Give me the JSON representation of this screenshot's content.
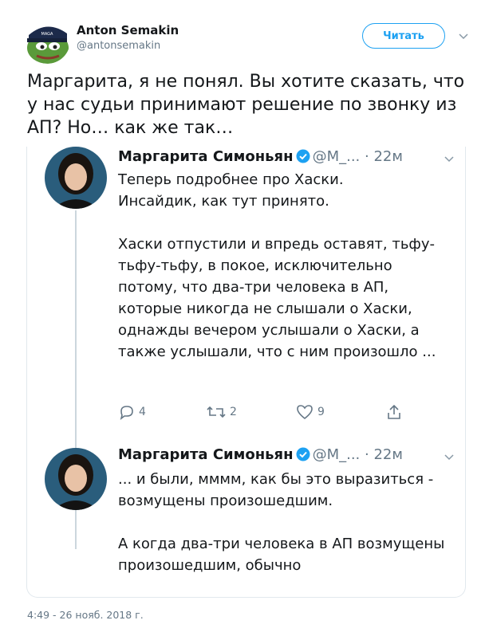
{
  "author": {
    "name": "Anton Semakin",
    "handle": "@antonsemakin",
    "follow_label": "Читать"
  },
  "tweet": {
    "text": "Маргарита, я не понял. Вы хотите сказать, что у нас судьи принимают решение по звонку из АП? Но… как же так…",
    "timestamp": "4:49 - 26 нояб. 2018 г."
  },
  "quoted_thread": [
    {
      "name": "Маргарита Симоньян",
      "handle": "@М_...",
      "time": "· 22м",
      "text": "Теперь подробнее про Хаски.\nИнсайдик, как тут принято.\n\nХаски отпустили и впредь оставят, тьфу-тьфу-тьфу, в покое, исключительно потому, что два-три человека в АП, которые никогда не слышали о Хаски, однажды вечером услышали о Хаски, а также услышали, что с ним произошло ...",
      "replies": "4",
      "retweets": "2",
      "likes": "9"
    },
    {
      "name": "Маргарита Симоньян",
      "handle": "@М_...",
      "time": "· 22м",
      "text": "... и были, мммм, как бы это выразиться - возмущены произошедшим.\n\nА когда два-три человека в АП возмущены произошедшим, обычно"
    }
  ],
  "colors": {
    "accent": "#1da1f2",
    "muted": "#657786",
    "border": "#e1e8ed"
  }
}
